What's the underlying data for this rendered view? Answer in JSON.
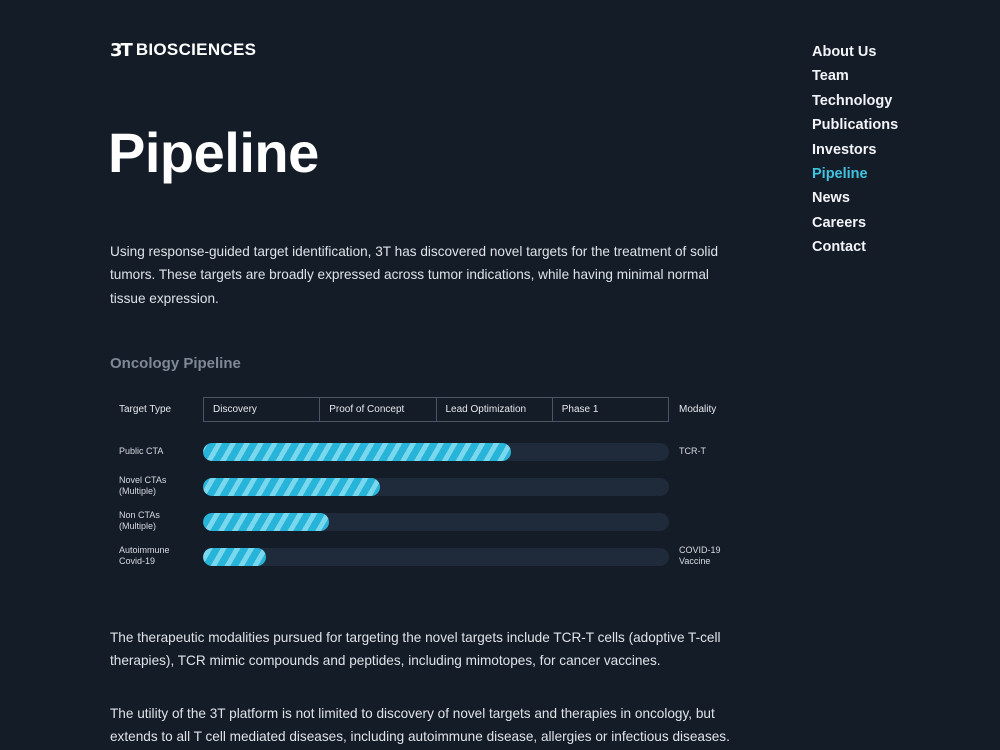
{
  "logo": {
    "mark": "3T",
    "text": "BIOSCIENCES"
  },
  "nav": {
    "items": [
      {
        "label": "About Us",
        "active": false
      },
      {
        "label": "Team",
        "active": false
      },
      {
        "label": "Technology",
        "active": false
      },
      {
        "label": "Publications",
        "active": false
      },
      {
        "label": "Investors",
        "active": false
      },
      {
        "label": "Pipeline",
        "active": true
      },
      {
        "label": "News",
        "active": false
      },
      {
        "label": "Careers",
        "active": false
      },
      {
        "label": "Contact",
        "active": false
      }
    ]
  },
  "page": {
    "title": "Pipeline",
    "intro": "Using response-guided target identification, 3T has discovered novel targets for the treatment of solid tumors. These targets are broadly expressed across tumor indications, while having minimal normal tissue expression.",
    "section_heading": "Oncology Pipeline",
    "paragraph_2": "The therapeutic modalities pursued for targeting the novel targets include TCR-T cells (adoptive T-cell therapies), TCR mimic compounds and peptides, including mimotopes, for cancer vaccines.",
    "paragraph_3": "The utility of the 3T platform is not limited to discovery of novel targets and therapies in oncology, but extends to all T cell mediated diseases, including autoimmune disease, allergies or infectious diseases."
  },
  "pipeline": {
    "target_type_label": "Target Type",
    "modality_label": "Modality",
    "phases": [
      "Discovery",
      "Proof of Concept",
      "Lead Optimization",
      "Phase 1"
    ],
    "rows": [
      {
        "target": "Public CTA",
        "progress": 0.66,
        "modality": "TCR-T"
      },
      {
        "target": "Novel CTAs\n(Multiple)",
        "progress": 0.38,
        "modality": ""
      },
      {
        "target": "Non CTAs\n(Multiple)",
        "progress": 0.27,
        "modality": ""
      },
      {
        "target": "Autoimmune\nCovid-19",
        "progress": 0.135,
        "modality": "COVID-19\nVaccine"
      }
    ]
  },
  "colors": {
    "background": "#141c27",
    "accent": "#3fc3e0",
    "bar_fill": "#28b4d8",
    "bar_stripe": "#79d7ee",
    "track": "#1f2b3b",
    "muted_heading": "#7f8896"
  }
}
